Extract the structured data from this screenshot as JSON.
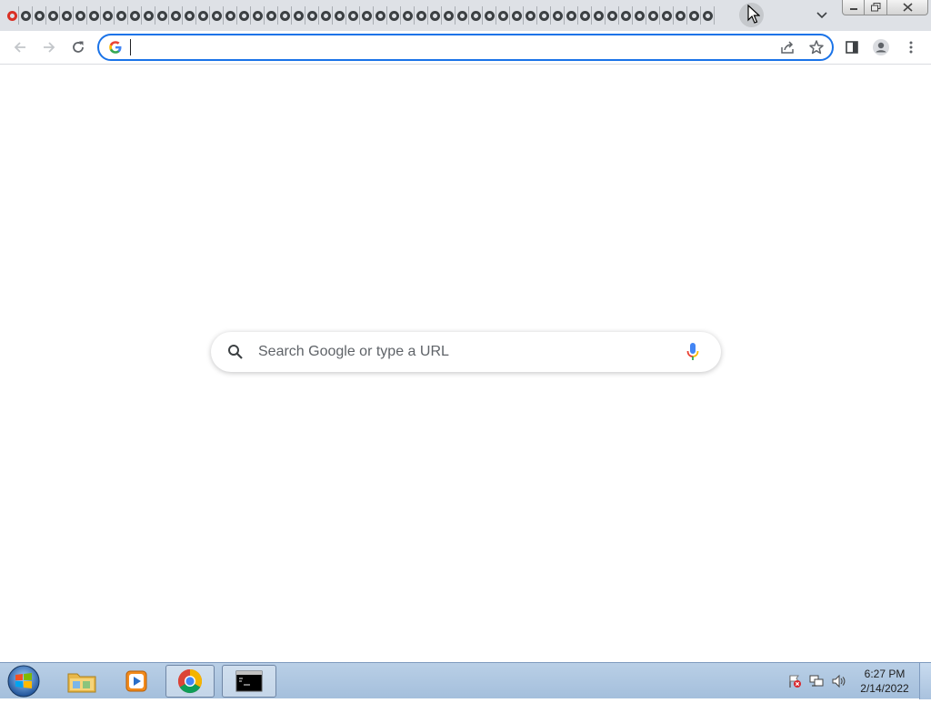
{
  "browser": {
    "tab_count": 52,
    "active_tab_index": 0,
    "omnibox": {
      "value": "",
      "placeholder": ""
    }
  },
  "new_tab_page": {
    "search_placeholder": "Search Google or type a URL"
  },
  "taskbar": {
    "apps": [
      {
        "name": "Windows Explorer",
        "icon": "folder-icon"
      },
      {
        "name": "Windows Media Player",
        "icon": "media-player-icon"
      },
      {
        "name": "Google Chrome",
        "icon": "chrome-icon",
        "active": true
      },
      {
        "name": "Command Prompt",
        "icon": "cmd-icon"
      }
    ],
    "clock": {
      "time": "6:27 PM",
      "date": "2/14/2022"
    }
  },
  "colors": {
    "accent": "#1a73e8",
    "tabstrip": "#dee1e6",
    "taskbar": "#b0c8e2"
  }
}
